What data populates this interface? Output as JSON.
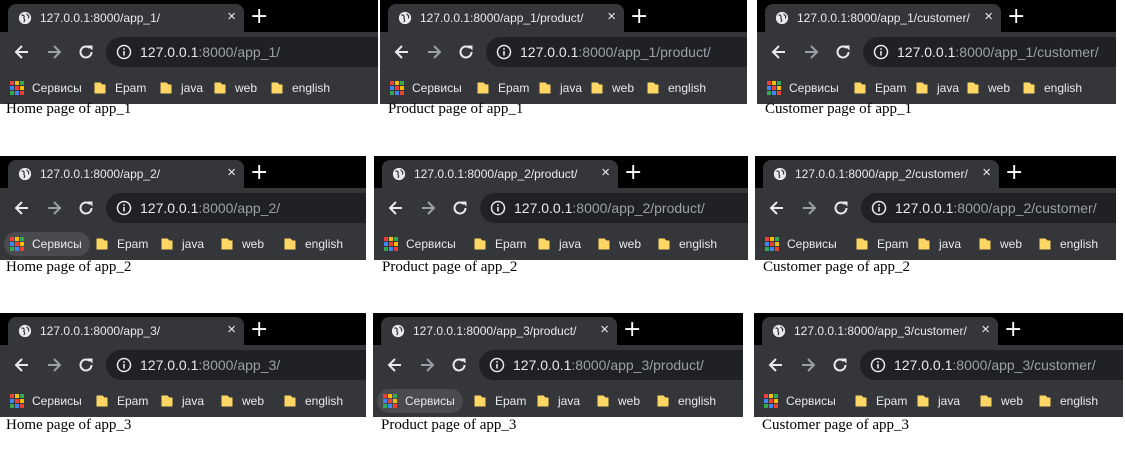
{
  "colors": {
    "frame": "#000000",
    "toolbar": "#35363a",
    "omnibox": "#202124",
    "text": "#e8eaed",
    "muted_text": "#9aa0a6",
    "folder": "#fdd663"
  },
  "icons": {
    "tab": "globe-icon",
    "new_tab": "plus-icon",
    "back": "arrow-left-icon",
    "forward": "arrow-right-icon",
    "reload": "reload-icon",
    "site_info": "info-icon",
    "apps": "apps-grid-icon",
    "bookmark": "folder-icon"
  },
  "bookmarks": {
    "apps_label": "Сервисы",
    "folders": [
      "Epam",
      "java",
      "web",
      "english"
    ]
  },
  "tab_close_symbol": "×",
  "new_tab_symbol": "+",
  "windows": [
    {
      "tab_title": "127.0.0.1:8000/app_1/",
      "url_host": "127.0.0.1",
      "url_rest": ":8000/app_1/",
      "caption": "Home page of app_1",
      "apps_hover": false
    },
    {
      "tab_title": "127.0.0.1:8000/app_1/product/",
      "url_host": "127.0.0.1",
      "url_rest": ":8000/app_1/product/",
      "caption": "Product page of app_1",
      "apps_hover": false
    },
    {
      "tab_title": "127.0.0.1:8000/app_1/customer/",
      "url_host": "127.0.0.1",
      "url_rest": ":8000/app_1/customer/",
      "caption": "Customer page of app_1",
      "apps_hover": false
    },
    {
      "tab_title": "127.0.0.1:8000/app_2/",
      "url_host": "127.0.0.1",
      "url_rest": ":8000/app_2/",
      "caption": "Home page of app_2",
      "apps_hover": true
    },
    {
      "tab_title": "127.0.0.1:8000/app_2/product/",
      "url_host": "127.0.0.1",
      "url_rest": ":8000/app_2/product/",
      "caption": "Product page of app_2",
      "apps_hover": false
    },
    {
      "tab_title": "127.0.0.1:8000/app_2/customer/",
      "url_host": "127.0.0.1",
      "url_rest": ":8000/app_2/customer/",
      "caption": "Customer page of app_2",
      "apps_hover": false
    },
    {
      "tab_title": "127.0.0.1:8000/app_3/",
      "url_host": "127.0.0.1",
      "url_rest": ":8000/app_3/",
      "caption": "Home page of app_3",
      "apps_hover": false
    },
    {
      "tab_title": "127.0.0.1:8000/app_3/product/",
      "url_host": "127.0.0.1",
      "url_rest": ":8000/app_3/product/",
      "caption": "Product page of app_3",
      "apps_hover": true
    },
    {
      "tab_title": "127.0.0.1:8000/app_3/customer/",
      "url_host": "127.0.0.1",
      "url_rest": ":8000/app_3/customer/",
      "caption": "Customer page of app_3",
      "apps_hover": false
    }
  ]
}
